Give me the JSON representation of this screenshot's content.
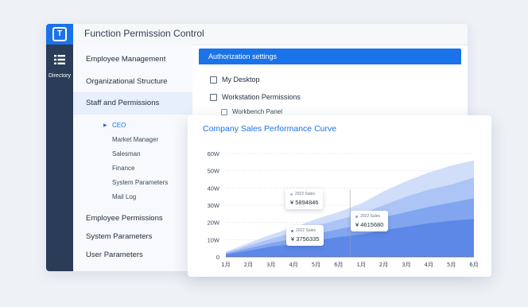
{
  "window": {
    "logo": "T",
    "title": "Function Permission Control"
  },
  "rail": {
    "icon": "list-icon",
    "label": "Directory"
  },
  "sidebar": {
    "items": [
      {
        "label": "Employee Management"
      },
      {
        "label": "Organizational Structure"
      },
      {
        "label": "Staff and Permissions",
        "active": true
      }
    ],
    "subitems": [
      {
        "label": "CEO",
        "active": true
      },
      {
        "label": "Market Manager"
      },
      {
        "label": "Salesman"
      },
      {
        "label": "Finance"
      },
      {
        "label": "System Parameters"
      },
      {
        "label": "Mail Log"
      }
    ],
    "bottom_items": [
      {
        "label": "Employee Permissions"
      },
      {
        "label": "System Parameters"
      },
      {
        "label": "User Parameters"
      }
    ]
  },
  "auth": {
    "header": "Authorization settings",
    "options": [
      {
        "label": "My Desktop",
        "checked": false
      },
      {
        "label": "Workstation Permissions",
        "checked": false
      },
      {
        "label": "Workbench Panel",
        "checked": false
      }
    ]
  },
  "chart": {
    "title": "Company Sales Performance Curve"
  },
  "tooltips": [
    {
      "label": "2022 Sales",
      "value": "¥ 5894846"
    },
    {
      "label": "2022 Sales",
      "value": "¥ 3756335"
    },
    {
      "label": "2022 Sales",
      "value": "¥ 4615680"
    }
  ],
  "chart_data": {
    "type": "area",
    "title": "Company Sales Performance Curve",
    "categories": [
      "1月",
      "2月",
      "3月",
      "4月",
      "5月",
      "6月",
      "1月",
      "2月",
      "3月",
      "4月",
      "5月",
      "6月"
    ],
    "y_ticks": [
      "0",
      "10W",
      "20W",
      "30W",
      "40W",
      "50W",
      "60W"
    ],
    "ylim": [
      0,
      60
    ],
    "series": [
      {
        "values": [
          3,
          8,
          13,
          17,
          22,
          26,
          31,
          38,
          44,
          49,
          53,
          56
        ],
        "color": "#cfdcf9"
      },
      {
        "values": [
          2.5,
          6.5,
          10.5,
          14,
          18,
          21.5,
          25,
          30,
          35,
          39,
          42,
          46
        ],
        "color": "#aac2f5"
      },
      {
        "values": [
          2,
          5,
          8,
          10.5,
          13.5,
          16,
          19,
          23,
          26,
          29,
          31.5,
          34
        ],
        "color": "#7fa3ee"
      },
      {
        "values": [
          1.5,
          3.5,
          6,
          7.5,
          9.5,
          11.5,
          13,
          15.5,
          17.5,
          19.5,
          21,
          22
        ],
        "color": "#5b86e6"
      }
    ],
    "grid": true,
    "legend": "none"
  }
}
